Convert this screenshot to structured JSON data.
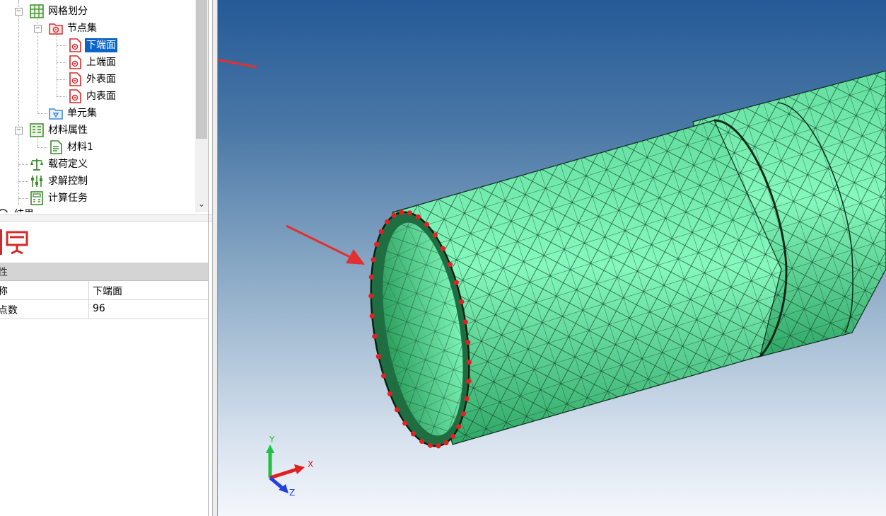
{
  "tree": {
    "items": [
      {
        "label": "网格划分",
        "icon": "mesh-icon"
      },
      {
        "label": "节点集",
        "icon": "node-set-folder-icon"
      },
      {
        "label": "下端面",
        "icon": "node-set-icon",
        "selected": true
      },
      {
        "label": "上端面",
        "icon": "node-set-icon"
      },
      {
        "label": "外表面",
        "icon": "node-set-icon"
      },
      {
        "label": "内表面",
        "icon": "node-set-icon"
      },
      {
        "label": "单元集",
        "icon": "element-set-folder-icon"
      },
      {
        "label": "材料属性",
        "icon": "material-properties-icon"
      },
      {
        "label": "材料1",
        "icon": "material-document-icon"
      },
      {
        "label": "载荷定义",
        "icon": "load-definition-icon"
      },
      {
        "label": "求解控制",
        "icon": "solve-control-icon"
      },
      {
        "label": "计算任务",
        "icon": "compute-task-icon"
      },
      {
        "label": "结果",
        "icon": "results-icon"
      }
    ]
  },
  "properties": {
    "header": "性",
    "rows": [
      {
        "key": "称",
        "value": "下端面"
      },
      {
        "key": "点数",
        "value": "96"
      }
    ]
  },
  "axes": {
    "x": "X",
    "y": "Y",
    "z": "Z"
  },
  "colors": {
    "selection": "#0a64c8",
    "mesh_fill": "#5fe0a0",
    "node_marker": "#e22222",
    "annotation_arrow": "#e23030",
    "axis_x": "#e02020",
    "axis_y": "#20c040",
    "axis_z": "#2040e0"
  }
}
